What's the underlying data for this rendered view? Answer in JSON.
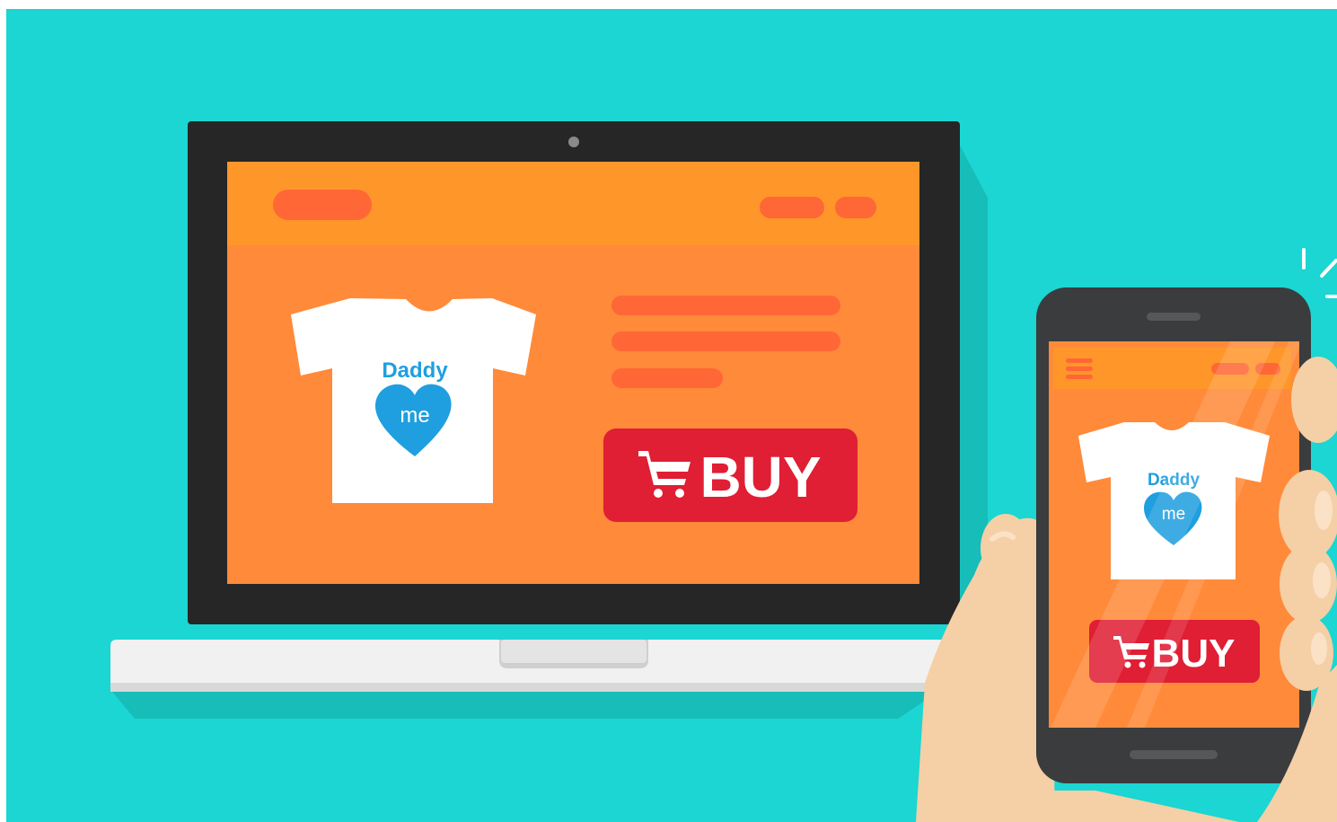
{
  "colors": {
    "background": "#1bd6d2",
    "background_shadow": "#17bdb9",
    "laptop_bezel": "#262626",
    "screen_orange": "#ff8a3a",
    "screen_header": "#ff962a",
    "nav_pill": "#ff6736",
    "buy_red": "#e01e34",
    "shirt_print_blue": "#1f9fdf",
    "skin": "#f5cfa6",
    "phone_body": "#3a3c3e"
  },
  "laptop": {
    "product_print": {
      "line1": "Daddy",
      "line2": "me"
    },
    "buy_button": {
      "label": "BUY",
      "icon": "shopping-cart-icon"
    }
  },
  "phone": {
    "menu_icon": "hamburger-menu-icon",
    "product_print": {
      "line1": "Daddy",
      "line2": "me"
    },
    "buy_button": {
      "label": "BUY",
      "icon": "shopping-cart-icon"
    }
  }
}
